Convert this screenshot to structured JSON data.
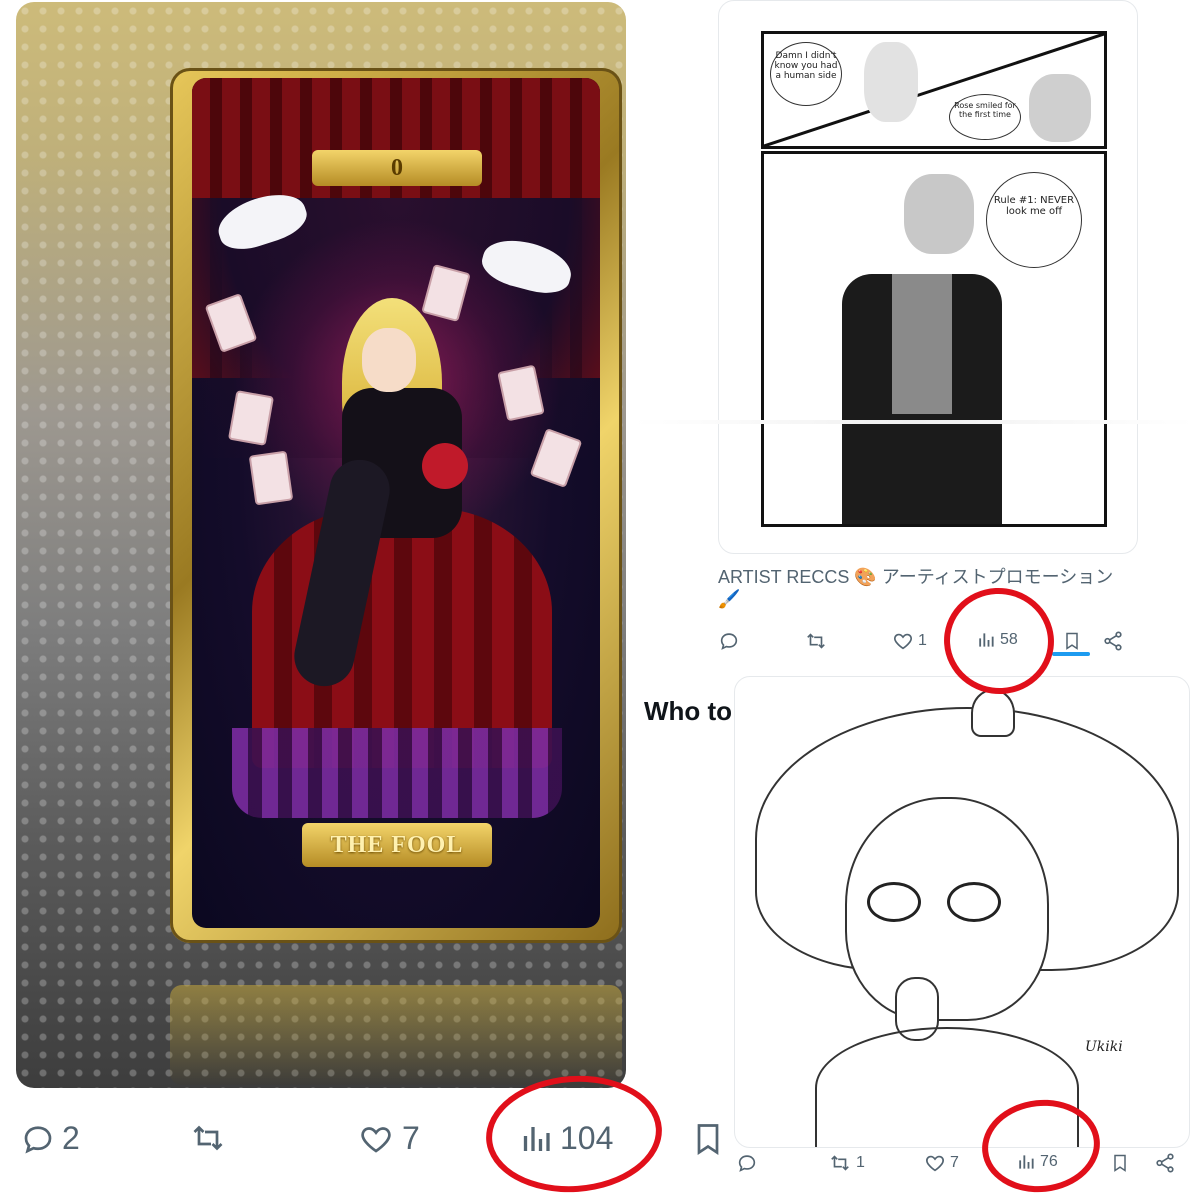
{
  "left_post": {
    "card_number": "0",
    "card_title": "THE FOOL",
    "actions": {
      "replies": "2",
      "likes": "7",
      "views": "104"
    }
  },
  "right_top_post": {
    "text": "ARTIST RECCS 🎨 アーティストプロモーション 🖌️",
    "actions": {
      "likes": "1",
      "views": "58"
    },
    "comic_bubbles": [
      "Damn I didn't know you had a human side",
      "Rose smiled for the first time",
      "Rule #1: NEVER look me off"
    ]
  },
  "who_to_follow": {
    "label": "Who to"
  },
  "right_bottom_post": {
    "signature": "Ukiki",
    "actions": {
      "reposts": "1",
      "likes": "7",
      "views": "76"
    }
  },
  "colors": {
    "action_grey": "#536471",
    "annotation_red": "#e10f1a",
    "gold": "#d9b44a"
  },
  "icons": [
    "reply-icon",
    "repost-icon",
    "like-icon",
    "views-icon",
    "bookmark-icon",
    "share-icon"
  ]
}
